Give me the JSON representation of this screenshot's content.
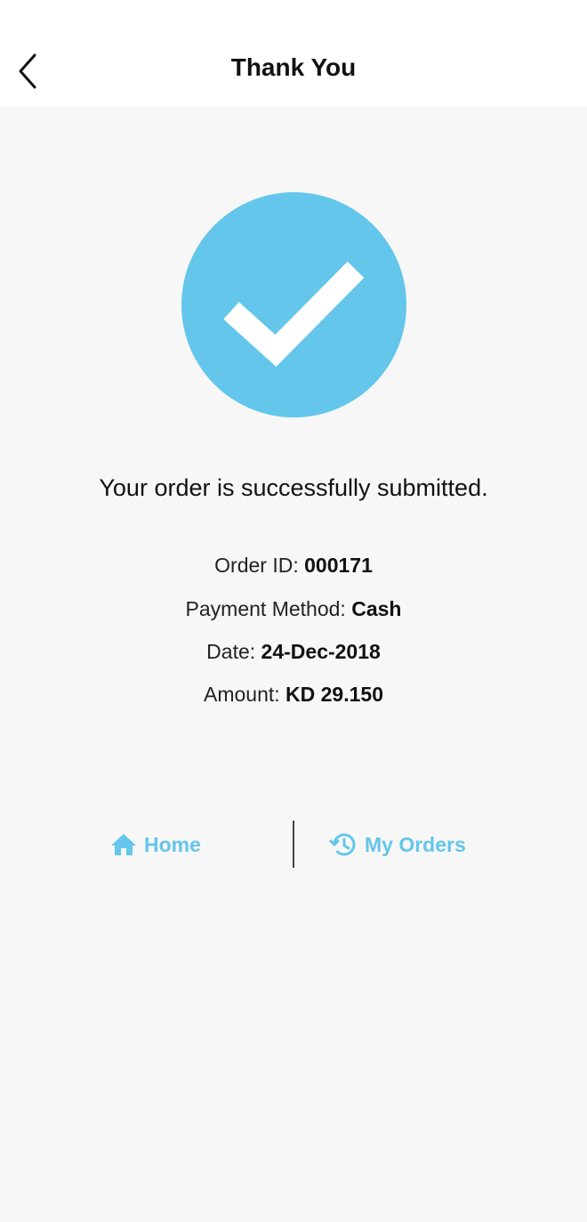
{
  "header": {
    "title": "Thank You",
    "back_icon": "chevron-left-icon"
  },
  "status": {
    "icon": "check-circle-icon",
    "icon_color": "#63c6ea",
    "message": "Your order is successfully submitted."
  },
  "order": {
    "order_id_label": "Order ID: ",
    "order_id": "000171",
    "payment_method_label": "Payment Method: ",
    "payment_method": "Cash",
    "date_label": "Date: ",
    "date": "24-Dec-2018",
    "amount_label": "Amount: ",
    "amount": "KD 29.150"
  },
  "actions": {
    "home_label": "Home",
    "home_icon": "home-icon",
    "my_orders_label": "My Orders",
    "my_orders_icon": "history-icon",
    "accent_color": "#63c6ea"
  }
}
